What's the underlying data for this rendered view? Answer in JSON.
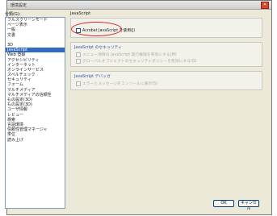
{
  "window": {
    "title": "環境設定",
    "close_icon": "close-icon"
  },
  "categories": {
    "label": "分類(G):",
    "group1": [
      "フルスクリーンモード",
      "ページ表示",
      "一般",
      "文書"
    ],
    "group2": [
      "3D",
      "JavaScript",
      "Web 登録",
      "アクセシビリティ",
      "インターネット",
      "オンラインサービス",
      "スペルチェック",
      "セキュリティ",
      "フォーム",
      "マルチメディア",
      "マルチメディアの信頼性",
      "もの設定(3D)",
      "もの設定(3D)",
      "ユーザ情報",
      "レビュー",
      "検索",
      "言語環境",
      "信頼性管理マネージャ",
      "単位",
      "読み上げ"
    ],
    "selected": "JavaScript"
  },
  "panel": {
    "title": "JavaScript",
    "groups": [
      {
        "options": [
          {
            "label": "Acrobat JavaScript を使用(J)",
            "checked": false,
            "enabled": true
          }
        ]
      },
      {
        "title": "JavaScript のセキュリティ",
        "options": [
          {
            "label": "メニュー項目の JavaScript 実行権限を有効にする(M)",
            "checked": false,
            "enabled": false
          },
          {
            "label": "グローバルオブジェクトのセキュリティポリシーを有効にする(G)",
            "checked": false,
            "enabled": false
          }
        ]
      },
      {
        "title": "JavaScript デバッガ",
        "options": [
          {
            "label": "エラーとメッセージをコンソールに表示(S)",
            "checked": false,
            "enabled": false
          }
        ]
      }
    ]
  },
  "buttons": {
    "ok": "OK",
    "cancel": "キャンセル"
  }
}
